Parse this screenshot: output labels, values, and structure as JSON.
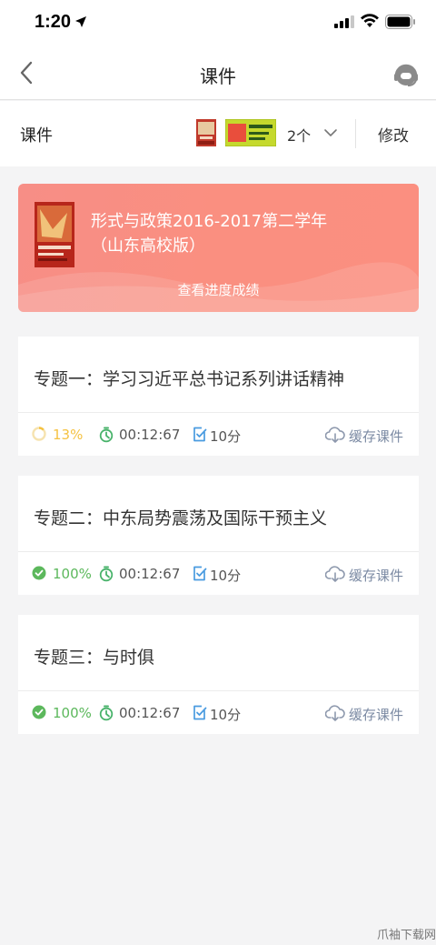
{
  "status_bar": {
    "time": "1:20"
  },
  "nav": {
    "title": "课件"
  },
  "course_row": {
    "label": "课件",
    "count": "2个",
    "edit_label": "修改"
  },
  "banner": {
    "title_line1": "形式与政策2016-2017第二学年",
    "title_line2": "（山东高校版）",
    "link_label": "查看进度成绩"
  },
  "topics": [
    {
      "title": "专题一：学习习近平总书记系列讲话精神",
      "progress": "13%",
      "progress_value": 0.13,
      "progress_color": "#f5c242",
      "duration": "00:12:67",
      "score": "10分",
      "cache_label": "缓存课件"
    },
    {
      "title": "专题二：中东局势震荡及国际干预主义",
      "progress": "100%",
      "progress_value": 1.0,
      "progress_color": "#5cb85c",
      "duration": "00:12:67",
      "score": "10分",
      "cache_label": "缓存课件"
    },
    {
      "title": "专题三：与时俱",
      "progress": "100%",
      "progress_value": 1.0,
      "progress_color": "#5cb85c",
      "duration": "00:12:67",
      "score": "10分",
      "cache_label": "缓存课件"
    }
  ],
  "colors": {
    "accent_banner": "#f98d82",
    "timer_green": "#49b36b",
    "score_blue": "#4a9be0",
    "cache_gray": "#7b8aa3"
  },
  "icons": [
    "location-arrow-icon",
    "signal-icon",
    "wifi-icon",
    "battery-icon",
    "back-icon",
    "headset-support-icon",
    "chevron-down-icon",
    "progress-ring-icon",
    "check-circle-icon",
    "timer-icon",
    "score-icon",
    "cloud-download-icon"
  ],
  "watermark": "爪袖下载网"
}
